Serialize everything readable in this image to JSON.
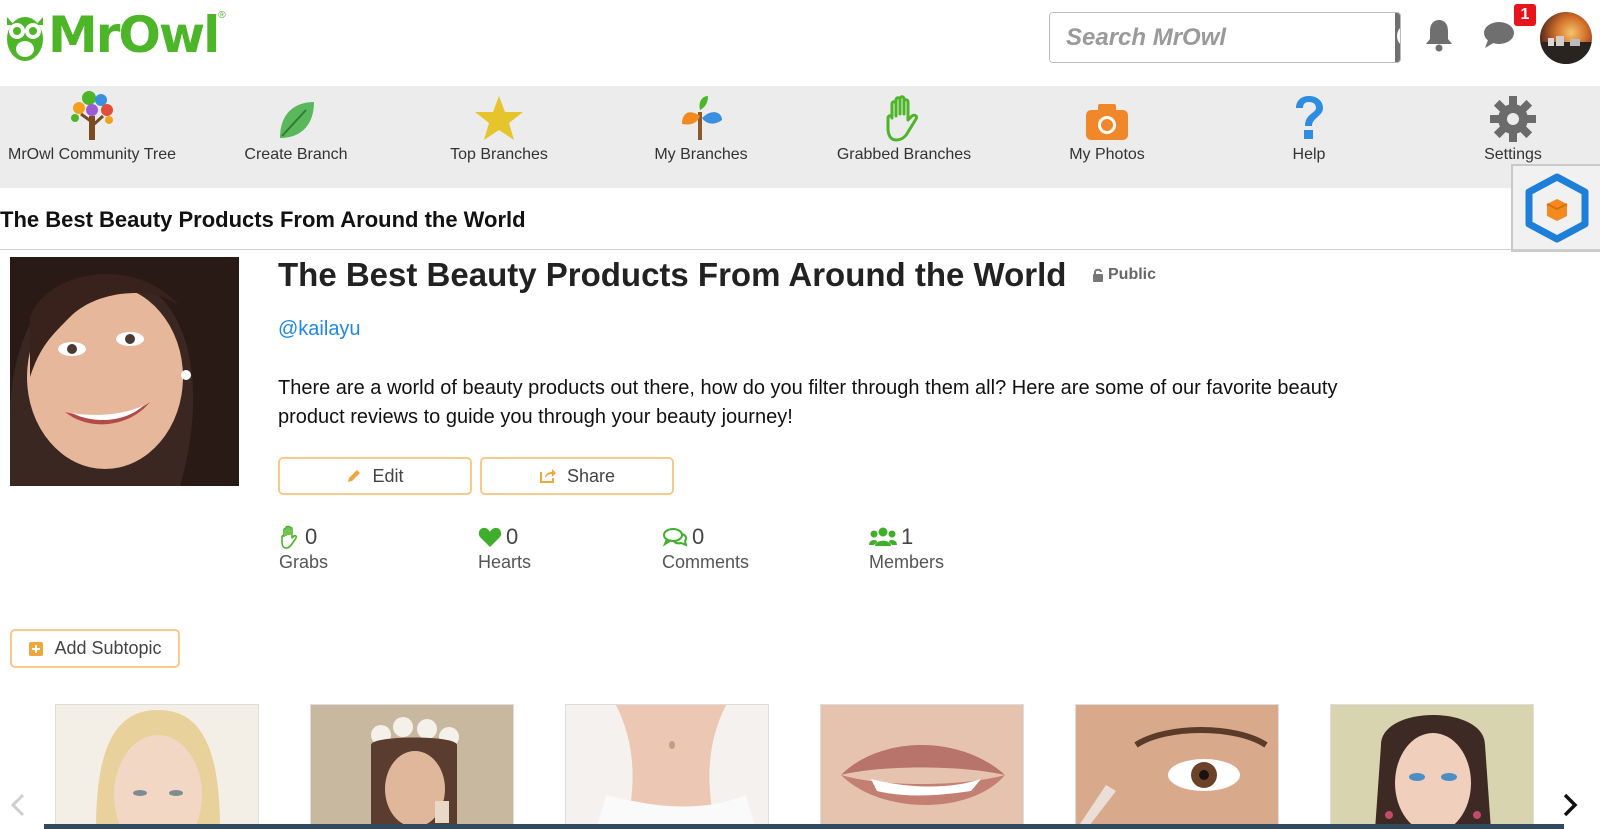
{
  "header": {
    "logo_text": "MrOwl",
    "logo_reg": "®",
    "search_placeholder": "Search MrOwl",
    "message_badge": "1",
    "icons": [
      "owl-logo-icon",
      "search-icon",
      "bell-icon",
      "chat-icon"
    ]
  },
  "nav": {
    "items": [
      {
        "label": "MrOwl Community Tree",
        "icon": "community-tree-icon"
      },
      {
        "label": "Create Branch",
        "icon": "leaf-icon"
      },
      {
        "label": "Top Branches",
        "icon": "star-icon"
      },
      {
        "label": "My Branches",
        "icon": "sprout-icon"
      },
      {
        "label": "Grabbed Branches",
        "icon": "hand-icon"
      },
      {
        "label": "My Photos",
        "icon": "camera-icon"
      },
      {
        "label": "Help",
        "icon": "question-icon"
      },
      {
        "label": "Settings",
        "icon": "gear-icon"
      }
    ]
  },
  "page": {
    "breadcrumb_title": "The Best Beauty Products From Around the World",
    "title": "The Best Beauty Products From Around the World",
    "visibility": "Public",
    "owner": "@kailayu",
    "description": "There are a world of beauty products out there, how do you filter through them all? Here are some of our favorite beauty product reviews to guide you through your beauty journey!",
    "edit_label": "Edit",
    "share_label": "Share",
    "add_subtopic_label": "Add Subtopic"
  },
  "stats": [
    {
      "value": "0",
      "label": "Grabs",
      "icon": "grab-hand-icon"
    },
    {
      "value": "0",
      "label": "Hearts",
      "icon": "heart-icon"
    },
    {
      "value": "0",
      "label": "Comments",
      "icon": "comments-icon"
    },
    {
      "value": "1",
      "label": "Members",
      "icon": "members-icon"
    }
  ],
  "colors": {
    "brand_green": "#4cb528",
    "link_blue": "#1e88e5",
    "button_border": "#f7c98a",
    "nav_bg": "#ececec",
    "badge_red": "#e8141c"
  }
}
